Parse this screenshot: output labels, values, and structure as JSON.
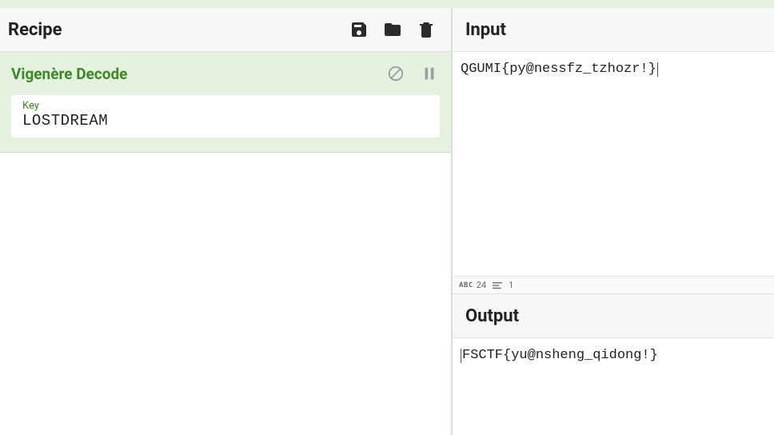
{
  "recipe": {
    "title": "Recipe",
    "operation": {
      "name": "Vigenère Decode",
      "key_label": "Key",
      "key_value": "LOSTDREAM"
    }
  },
  "input": {
    "title": "Input",
    "value": "QGUMI{py@nessfz_tzhozr!}",
    "char_count": "24",
    "line_count": "1"
  },
  "output": {
    "title": "Output",
    "value": "FSCTF{yu@nsheng_qidong!}"
  },
  "colors": {
    "accent_green": "#3c8a25",
    "card_bg": "#e6f2e0"
  }
}
